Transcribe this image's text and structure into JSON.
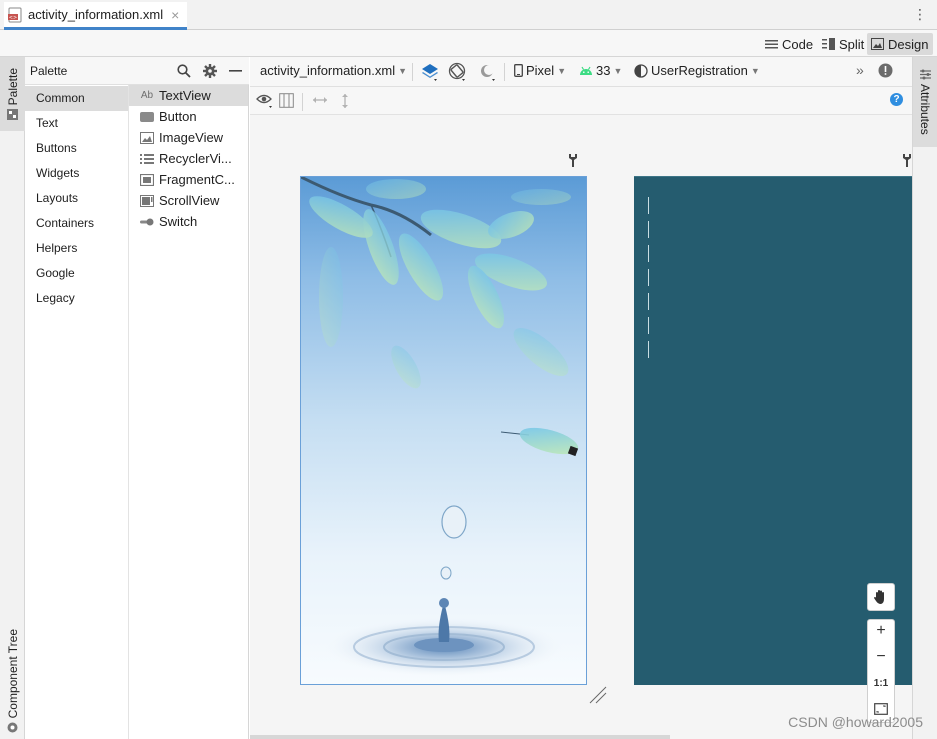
{
  "tab": {
    "file_name": "activity_information.xml",
    "close_symbol": "×",
    "more_symbol": "⋮"
  },
  "modes": {
    "code": "Code",
    "split": "Split",
    "design": "Design",
    "active": "Design"
  },
  "left_strip": {
    "palette": "Palette",
    "component_tree": "Component Tree"
  },
  "palette": {
    "title": "Palette",
    "categories": [
      {
        "label": "Common",
        "selected": true
      },
      {
        "label": "Text"
      },
      {
        "label": "Buttons"
      },
      {
        "label": "Widgets"
      },
      {
        "label": "Layouts"
      },
      {
        "label": "Containers"
      },
      {
        "label": "Helpers"
      },
      {
        "label": "Google"
      },
      {
        "label": "Legacy"
      }
    ],
    "widgets": [
      {
        "label": "TextView",
        "icon_text": "Ab",
        "icon": "textview-icon",
        "selected": true
      },
      {
        "label": "Button",
        "icon": "button-icon"
      },
      {
        "label": "ImageView",
        "icon": "imageview-icon"
      },
      {
        "label": "RecyclerVi...",
        "icon": "recyclerview-icon"
      },
      {
        "label": "FragmentC...",
        "icon": "fragment-icon"
      },
      {
        "label": "ScrollView",
        "icon": "scrollview-icon"
      },
      {
        "label": "Switch",
        "icon": "switch-icon"
      }
    ]
  },
  "toolbar": {
    "file_select": "activity_information.xml",
    "device": "Pixel",
    "api_level": "33",
    "theme": "UserRegistration",
    "overflow_symbol": "»",
    "help_symbol": "?"
  },
  "right_strip": {
    "attributes": "Attributes"
  },
  "zoom": {
    "zoom_in": "+",
    "zoom_out": "−",
    "actual_size": "1:1"
  },
  "watermark": "CSDN @howard2005",
  "colors": {
    "accent": "#4083c9",
    "blueprint_bg": "#255c6f",
    "selected_bg": "#dcdcdc",
    "error_icon": "#6b6b6b"
  }
}
